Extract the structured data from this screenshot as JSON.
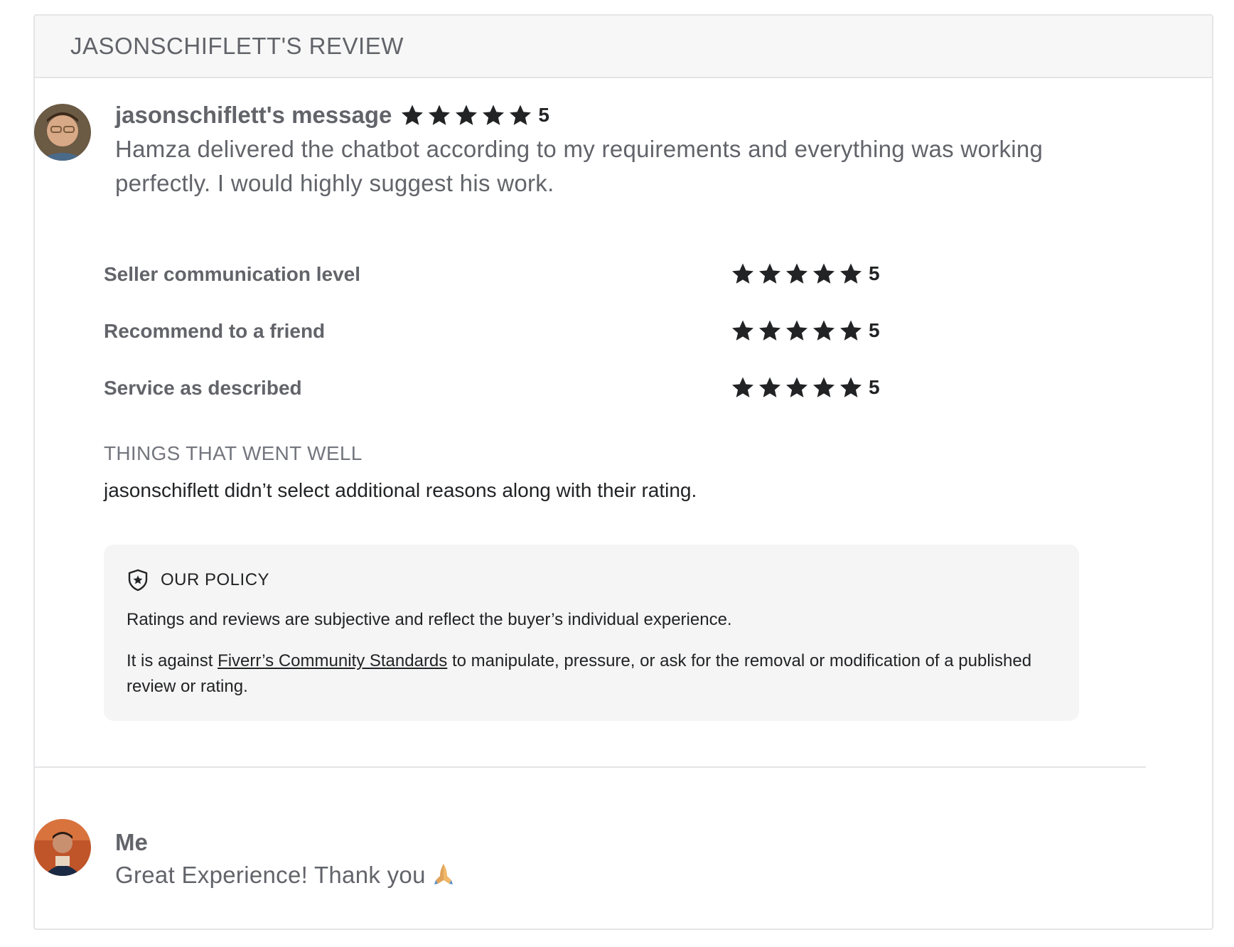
{
  "review": {
    "title": "JASONSCHIFLETT'S REVIEW",
    "buyer": {
      "avatar_icon": "buyer-avatar",
      "message_label": "jasonschiflett's message",
      "rating": "5",
      "stars": 5,
      "message": "Hamza delivered the chatbot according to my requirements and everything was working perfectly. I would highly suggest his work."
    },
    "criteria": [
      {
        "label": "Seller communication level",
        "rating": "5",
        "stars": 5
      },
      {
        "label": "Recommend to a friend",
        "rating": "5",
        "stars": 5
      },
      {
        "label": "Service as described",
        "rating": "5",
        "stars": 5
      }
    ],
    "went_well": {
      "title": "THINGS THAT WENT WELL",
      "text": "jasonschiflett didn’t select additional reasons along with their rating."
    },
    "policy": {
      "icon": "shield-star-icon",
      "title": "OUR POLICY",
      "line1": "Ratings and reviews are subjective and reflect the buyer’s individual experience.",
      "line2_prefix": "It is against ",
      "line2_link": "Fiverr’s Community Standards",
      "line2_suffix": " to manipulate, pressure, or ask for the removal or modification of a published review or rating."
    },
    "reply": {
      "author": "Me",
      "text": "Great Experience! Thank you",
      "emoji_icon": "praying-hands-icon"
    }
  },
  "colors": {
    "text_gray": "#62646a",
    "text_dark": "#222325",
    "star": "#222325",
    "header_bg": "#f7f7f7",
    "policy_bg": "#f5f5f5",
    "border": "#e4e5e7"
  }
}
